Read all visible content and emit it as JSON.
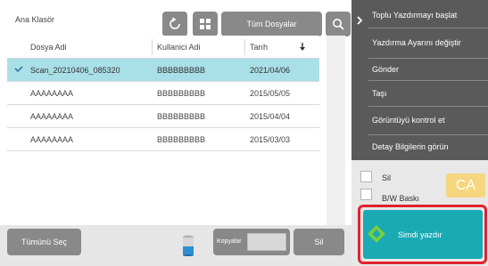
{
  "header": {
    "folder_title": "Ana Klasör",
    "all_files_label": "Tüm Dosyalar"
  },
  "table": {
    "columns": {
      "name": "Dosya Adi",
      "user": "Kullanici Adi",
      "date": "Tarıh"
    },
    "rows": [
      {
        "name": "Scan_20210406_085320",
        "user": "BBBBBBBBB",
        "date": "2021/04/06",
        "selected": true
      },
      {
        "name": "AAAAAAAA",
        "user": "BBBBBBBBB",
        "date": "2015/05/05",
        "selected": false
      },
      {
        "name": "AAAAAAAA",
        "user": "BBBBBBBBB",
        "date": "2015/04/04",
        "selected": false
      },
      {
        "name": "AAAAAAAA",
        "user": "BBBBBBBBB",
        "date": "2015/03/03",
        "selected": false
      }
    ]
  },
  "bottom": {
    "select_all_label": "Tümünü Seç",
    "copies_label": "Kopyalar",
    "delete_label": "Sil"
  },
  "side": {
    "menu_items": [
      "Toplu Yazdırmayı başlat",
      "Yazdırma Ayarını değiştir",
      "Gönder",
      "Taşı",
      "Görüntüyü kontrol et",
      "Detay Bilgilerin görün"
    ],
    "checkbox_delete_label": "Sil",
    "checkbox_bw_label": "B/W Baskı",
    "ca_label": "CA",
    "print_now_label": "Simdi yazdır"
  },
  "colors": {
    "button_gray": "#898989",
    "selected_row": "#a9dfe7",
    "menu_bg": "#5a5a5a",
    "print_button": "#1aaab4",
    "highlight_frame": "#e3212d",
    "ca_button": "#f6d67e"
  },
  "icons": {
    "refresh": "refresh-icon",
    "grid": "grid-view-icon",
    "search": "search-icon",
    "sort": "sort-down-arrow-icon",
    "check": "checkmark-icon",
    "toner": "toner-icon",
    "menu_toggle": "chevron-right-icon",
    "print": "start-diamond-icon"
  }
}
